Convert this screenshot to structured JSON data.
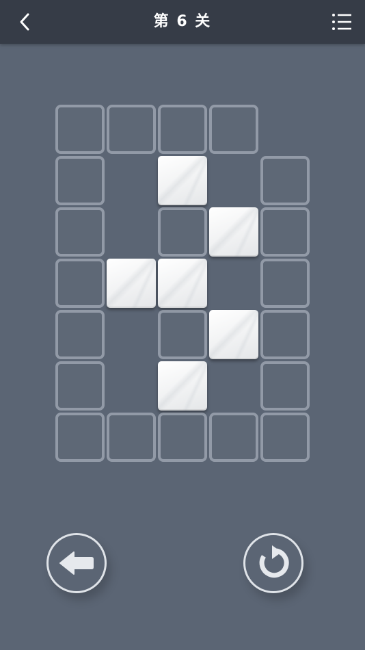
{
  "header": {
    "title": "第 6 关",
    "back_icon": "chevron-left-icon",
    "menu_icon": "list-menu-icon"
  },
  "board": {
    "columns": 5,
    "rows": 7,
    "cells": [
      {
        "row": 0,
        "col": 0,
        "state": "empty"
      },
      {
        "row": 0,
        "col": 1,
        "state": "empty"
      },
      {
        "row": 0,
        "col": 2,
        "state": "empty"
      },
      {
        "row": 0,
        "col": 3,
        "state": "empty"
      },
      {
        "row": 1,
        "col": 0,
        "state": "empty"
      },
      {
        "row": 1,
        "col": 2,
        "state": "filled"
      },
      {
        "row": 1,
        "col": 4,
        "state": "empty"
      },
      {
        "row": 2,
        "col": 0,
        "state": "empty"
      },
      {
        "row": 2,
        "col": 2,
        "state": "empty"
      },
      {
        "row": 2,
        "col": 3,
        "state": "filled"
      },
      {
        "row": 2,
        "col": 4,
        "state": "empty"
      },
      {
        "row": 3,
        "col": 0,
        "state": "empty"
      },
      {
        "row": 3,
        "col": 1,
        "state": "filled"
      },
      {
        "row": 3,
        "col": 2,
        "state": "filled"
      },
      {
        "row": 3,
        "col": 4,
        "state": "empty"
      },
      {
        "row": 4,
        "col": 0,
        "state": "empty"
      },
      {
        "row": 4,
        "col": 2,
        "state": "empty"
      },
      {
        "row": 4,
        "col": 3,
        "state": "filled"
      },
      {
        "row": 4,
        "col": 4,
        "state": "empty"
      },
      {
        "row": 5,
        "col": 0,
        "state": "empty"
      },
      {
        "row": 5,
        "col": 2,
        "state": "filled"
      },
      {
        "row": 5,
        "col": 4,
        "state": "empty"
      },
      {
        "row": 6,
        "col": 0,
        "state": "empty"
      },
      {
        "row": 6,
        "col": 1,
        "state": "empty"
      },
      {
        "row": 6,
        "col": 2,
        "state": "empty"
      },
      {
        "row": 6,
        "col": 3,
        "state": "empty"
      },
      {
        "row": 6,
        "col": 4,
        "state": "empty"
      }
    ]
  },
  "controls": {
    "undo_icon": "arrow-left-icon",
    "restart_icon": "restart-icon"
  },
  "colors": {
    "background": "#5b6574",
    "topbar": "#363c47",
    "outline": "#dfe3e8",
    "tile": "#f1f2f3"
  }
}
